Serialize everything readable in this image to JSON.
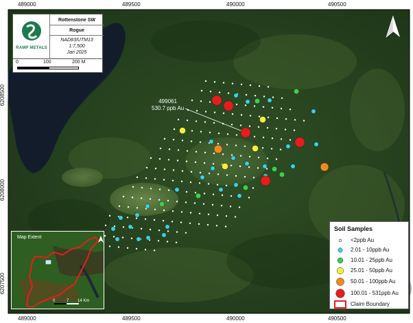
{
  "title_block": {
    "title": "Rottenstone SW",
    "subtitle": "Rogue",
    "projection": "NAD83/UTM13",
    "scale": "1:7,500",
    "date": "Jan 2025",
    "company": "RAMP METALS",
    "brand_color": "#1d7a4f"
  },
  "scale_bar": {
    "labels": [
      "0",
      "100",
      "200 M"
    ]
  },
  "grid_labels": {
    "easting_top": [
      "489000",
      "489500",
      "490000",
      "490500"
    ],
    "easting_bottom": [
      "489000",
      "489500",
      "490000",
      "490500"
    ],
    "northing_left": [
      "6208500",
      "6208000",
      "6207500"
    ]
  },
  "callout": {
    "sample_id": "499061",
    "value": "530.7 ppb Au"
  },
  "legend": {
    "title": "Soil Samples",
    "items": [
      {
        "label": "<2ppb Au",
        "color": "#ffffff"
      },
      {
        "label": "2.01 - 10ppb Au",
        "color": "#36d4e6"
      },
      {
        "label": "10.01 - 25ppb Au",
        "color": "#3ccf4a"
      },
      {
        "label": "25.01 - 50ppb Au",
        "color": "#f4f03a"
      },
      {
        "label": "50.01 - 100ppb Au",
        "color": "#f08a1c"
      },
      {
        "label": "100.01 - 531ppb Au",
        "color": "#e81c1c"
      },
      {
        "label": "Claim Boundary",
        "color": "#e81c1c"
      }
    ]
  },
  "inset": {
    "label": "Map Extent",
    "scale_labels": [
      "0",
      "7",
      "14 Km"
    ]
  },
  "samples": {
    "high": [
      [
        316,
        146
      ],
      [
        333,
        154
      ],
      [
        358,
        193
      ],
      [
        437,
        207
      ],
      [
        387,
        263
      ]
    ],
    "orange": [
      [
        318,
        217
      ],
      [
        473,
        243
      ]
    ],
    "yellow": [
      [
        266,
        190
      ],
      [
        383,
        174
      ],
      [
        328,
        242
      ],
      [
        372,
        216
      ]
    ],
    "green": [
      [
        432,
        133
      ],
      [
        375,
        147
      ],
      [
        400,
        246
      ],
      [
        411,
        254
      ],
      [
        358,
        273
      ],
      [
        289,
        285
      ],
      [
        236,
        297
      ]
    ],
    "cyan": [
      [
        344,
        139
      ],
      [
        361,
        148
      ],
      [
        393,
        146
      ],
      [
        308,
        206
      ],
      [
        340,
        230
      ],
      [
        420,
        213
      ],
      [
        461,
        210
      ],
      [
        360,
        238
      ],
      [
        386,
        242
      ],
      [
        427,
        242
      ],
      [
        310,
        245
      ],
      [
        344,
        269
      ],
      [
        387,
        256
      ],
      [
        457,
        162
      ],
      [
        295,
        258
      ],
      [
        349,
        285
      ],
      [
        322,
        276
      ],
      [
        258,
        276
      ],
      [
        215,
        300
      ],
      [
        200,
        313
      ],
      [
        176,
        317
      ],
      [
        165,
        333
      ],
      [
        190,
        330
      ],
      [
        202,
        348
      ],
      [
        216,
        346
      ],
      [
        239,
        342
      ],
      [
        244,
        330
      ],
      [
        171,
        348
      ]
    ]
  }
}
